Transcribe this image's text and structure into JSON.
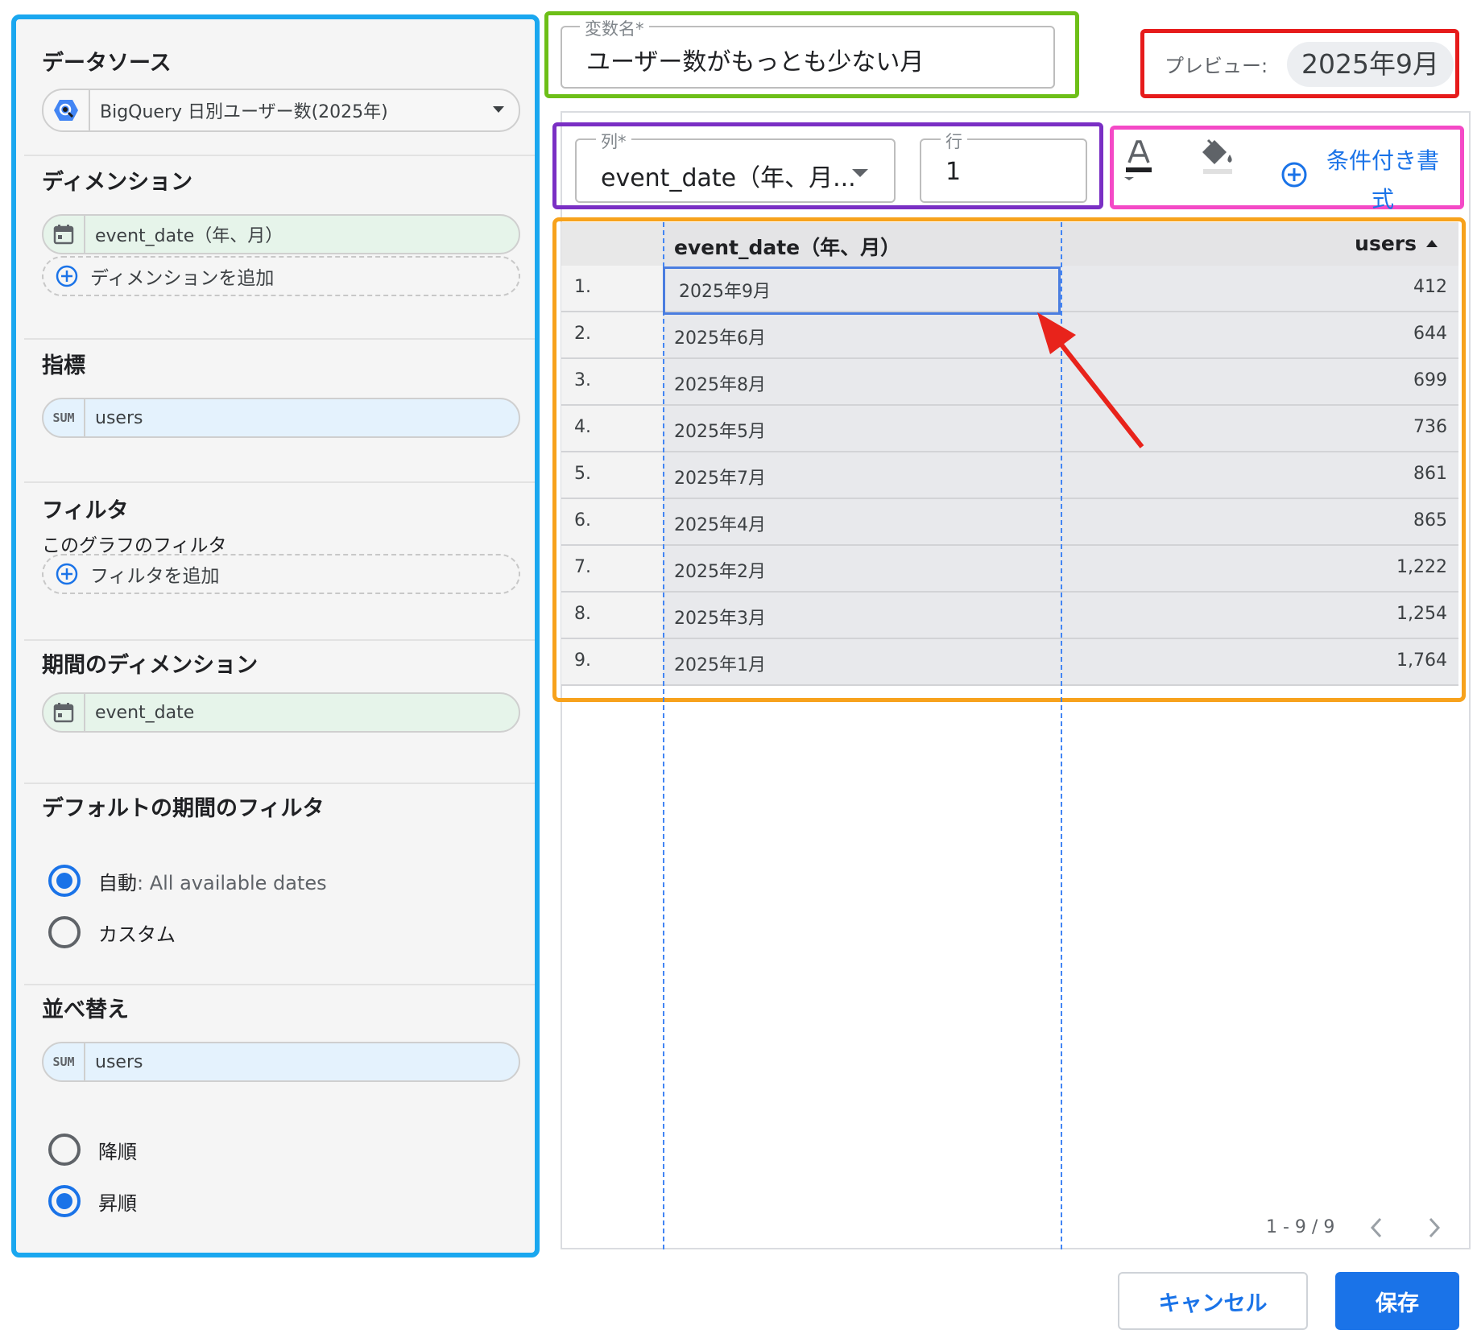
{
  "colors": {
    "accent": "#1a73e8",
    "highlight_blue": "#1aa7ef",
    "highlight_green": "#6dbf18",
    "highlight_red": "#e61b1b",
    "highlight_purple": "#7a2fc4",
    "highlight_pink": "#f449c6",
    "highlight_orange": "#f7a21c",
    "arrow_red": "#e8231b"
  },
  "left_panel": {
    "data_source": {
      "title": "データソース",
      "icon": "bigquery-icon",
      "selected": "BigQuery 日別ユーザー数(2025年)",
      "dropdown_icon": "caret-down-icon"
    },
    "dimension": {
      "title": "ディメンション",
      "chip": "event_date（年、月）",
      "chip_icon": "calendar-icon",
      "add_label": "ディメンションを追加",
      "add_icon": "add-circle-icon"
    },
    "metric": {
      "title": "指標",
      "badge": "SUM",
      "chip": "users"
    },
    "filter": {
      "title": "フィルタ",
      "subtitle": "このグラフのフィルタ",
      "add_label": "フィルタを追加"
    },
    "period_dimension": {
      "title": "期間のディメンション",
      "chip": "event_date"
    },
    "default_period": {
      "title": "デフォルトの期間のフィルタ",
      "option_auto": "自動",
      "option_auto_detail": ": All available dates",
      "option_custom": "カスタム",
      "selected": "auto"
    },
    "sort": {
      "title": "並べ替え",
      "badge": "SUM",
      "chip": "users",
      "option_desc": "降順",
      "option_asc": "昇順",
      "selected": "asc"
    }
  },
  "variable": {
    "legend": "変数名*",
    "value": "ユーザー数がもっとも少ない月"
  },
  "preview": {
    "label": "プレビュー:",
    "value": "2025年9月"
  },
  "selector": {
    "column_legend": "列*",
    "column_value": "event_date（年、月...",
    "row_legend": "行",
    "row_value": "1"
  },
  "formatting": {
    "text_color_icon": "text-color-icon",
    "fill_color_icon": "fill-color-icon",
    "conditional_label_1": "条件付き書",
    "conditional_label_2": "式"
  },
  "table": {
    "columns": [
      "",
      "event_date（年、月）",
      "users"
    ],
    "sort_icon": "sort-ascending-icon",
    "rows": [
      {
        "n": "1.",
        "date": "2025年9月",
        "users": "412"
      },
      {
        "n": "2.",
        "date": "2025年6月",
        "users": "644"
      },
      {
        "n": "3.",
        "date": "2025年8月",
        "users": "699"
      },
      {
        "n": "4.",
        "date": "2025年5月",
        "users": "736"
      },
      {
        "n": "5.",
        "date": "2025年7月",
        "users": "861"
      },
      {
        "n": "6.",
        "date": "2025年4月",
        "users": "865"
      },
      {
        "n": "7.",
        "date": "2025年2月",
        "users": "1,222"
      },
      {
        "n": "8.",
        "date": "2025年3月",
        "users": "1,254"
      },
      {
        "n": "9.",
        "date": "2025年1月",
        "users": "1,764"
      }
    ],
    "selected_row": 1,
    "pagination": "1 - 9 / 9"
  },
  "buttons": {
    "cancel": "キャンセル",
    "save": "保存"
  }
}
